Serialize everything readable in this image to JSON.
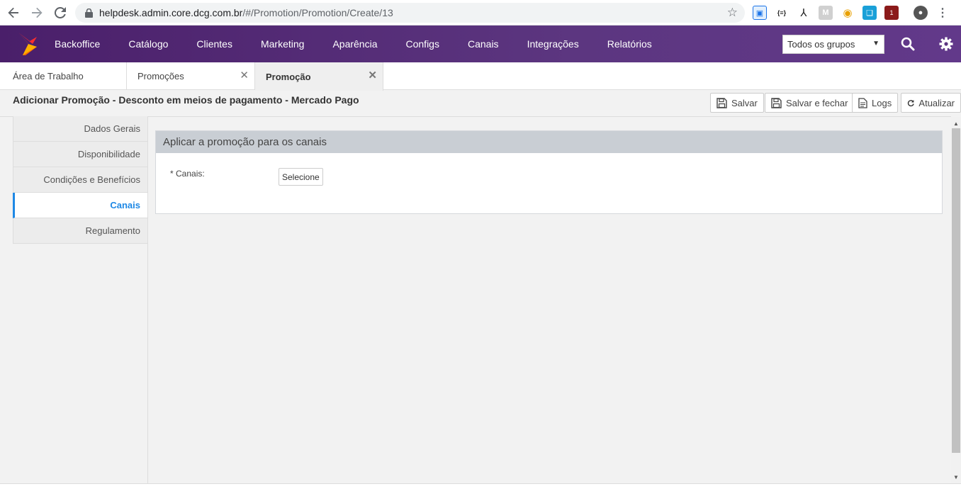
{
  "browser": {
    "url_host": "helpdesk.admin.core.dcg.com.br",
    "url_path": "/#/Promotion/Promotion/Create/13"
  },
  "topnav": {
    "menu": [
      "Backoffice",
      "Catálogo",
      "Clientes",
      "Marketing",
      "Aparência",
      "Configs",
      "Canais",
      "Integrações",
      "Relatórios"
    ],
    "group_select": "Todos os grupos"
  },
  "tabs": [
    {
      "label": "Área de Trabalho"
    },
    {
      "label": "Promoções"
    },
    {
      "label": "Promoção"
    }
  ],
  "page": {
    "title": "Adicionar Promoção - Desconto em meios de pagamento - Mercado Pago",
    "actions": {
      "save": "Salvar",
      "save_close": "Salvar e fechar",
      "logs": "Logs",
      "refresh": "Atualizar"
    }
  },
  "sidemenu": [
    "Dados Gerais",
    "Disponibilidade",
    "Condições e Benefícios",
    "Canais",
    "Regulamento"
  ],
  "panel": {
    "title": "Aplicar a promoção para os canais",
    "field_label": "* Canais:",
    "select_button": "Selecione"
  },
  "colors": {
    "nav_purple": "#5c3680",
    "accent_blue": "#1e88e5",
    "panel_header": "#c9ced4"
  }
}
